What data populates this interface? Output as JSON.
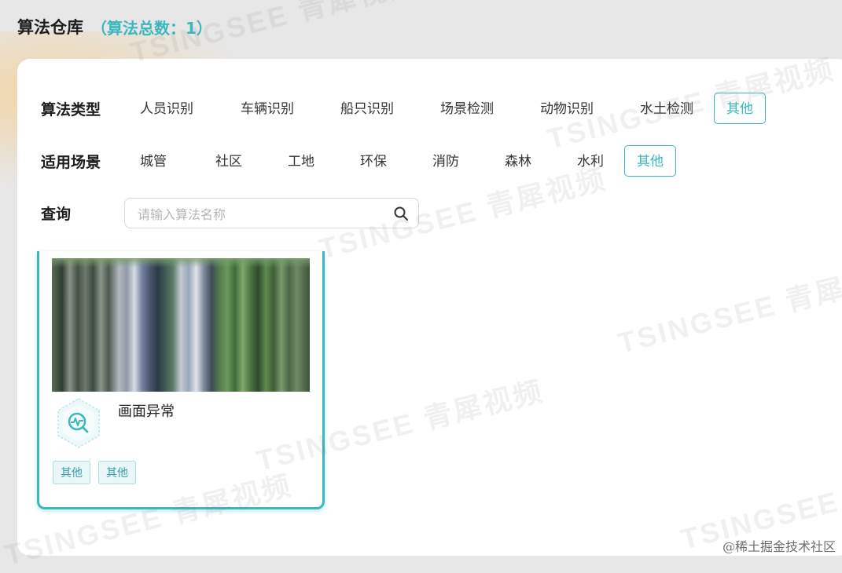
{
  "header": {
    "title": "算法仓库",
    "count_text": "（算法总数：1）"
  },
  "filters": {
    "algorithm_type": {
      "label": "算法类型",
      "options": [
        "人员识别",
        "车辆识别",
        "船只识别",
        "场景检测",
        "动物识别",
        "水土检测",
        "其他"
      ],
      "selected": "其他"
    },
    "scenario": {
      "label": "适用场景",
      "options": [
        "城管",
        "社区",
        "工地",
        "环保",
        "消防",
        "森林",
        "水利",
        "其他"
      ],
      "selected": "其他"
    },
    "query": {
      "label": "查询",
      "placeholder": "请输入算法名称",
      "value": ""
    }
  },
  "cards": [
    {
      "title": "画面异常",
      "icon": "abnormal-detection-icon",
      "tags": [
        "其他",
        "其他"
      ]
    }
  ],
  "watermark_text": "TSINGSEE 青犀视频",
  "credit": "@稀土掘金技术社区",
  "colors": {
    "accent": "#3bb7bd",
    "background": "#e7e7e7",
    "panel": "#ffffff"
  }
}
